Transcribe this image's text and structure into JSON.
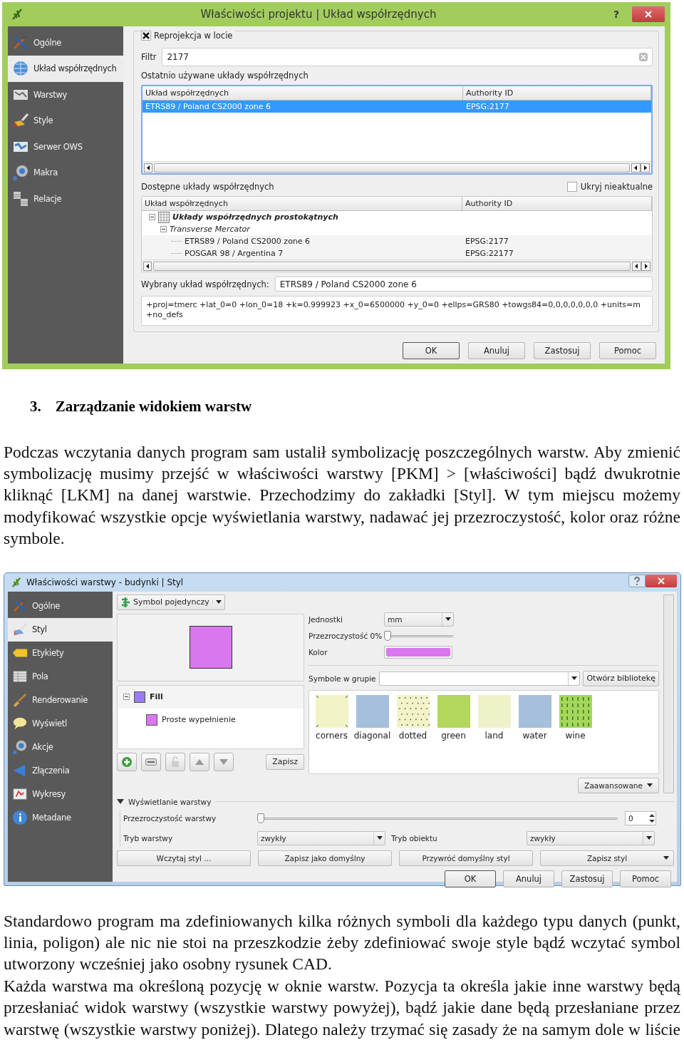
{
  "dialog1": {
    "title": "Właściwości projektu | Układ współrzędnych",
    "help": "?",
    "sidebar": [
      {
        "label": "Ogólne",
        "selected": false
      },
      {
        "label": "Układ współrzędnych",
        "selected": true
      },
      {
        "label": "Warstwy",
        "selected": false
      },
      {
        "label": "Style",
        "selected": false
      },
      {
        "label": "Serwer OWS",
        "selected": false
      },
      {
        "label": "Makra",
        "selected": false
      },
      {
        "label": "Relacje",
        "selected": false
      }
    ],
    "reprojection": {
      "label": "Reprojekcja w locie",
      "checked": true
    },
    "filter": {
      "label": "Filtr",
      "value": "2177"
    },
    "recent": {
      "label": "Ostatnio używane układy współrzędnych",
      "columns": [
        "Układ współrzędnych",
        "Authority ID"
      ],
      "rows": [
        {
          "cells": [
            "ETRS89 / Poland CS2000 zone 6",
            "EPSG:2177"
          ],
          "selected": true
        }
      ]
    },
    "available": {
      "label": "Dostępne układy współrzędnych",
      "hide_deprecated": {
        "label": "Ukryj nieaktualne",
        "checked": false
      },
      "columns": [
        "Układ współrzędnych",
        "Authority ID"
      ],
      "tree": [
        {
          "label": "Układy współrzędnych prostokątnych",
          "expanded": true,
          "children": [
            {
              "label": "Transverse Mercator",
              "expanded": true,
              "children": [
                {
                  "label": "ETRS89 / Poland CS2000 zone 6",
                  "authority_id": "EPSG:2177"
                },
                {
                  "label": "POSGAR 98 / Argentina 7",
                  "authority_id": "EPSG:22177"
                }
              ]
            }
          ]
        }
      ]
    },
    "selected_crs": {
      "label": "Wybrany układ współrzędnych:",
      "value": "ETRS89 / Poland CS2000 zone 6"
    },
    "proj_string": "+proj=tmerc +lat_0=0 +lon_0=18 +k=0.999923 +x_0=6500000 +y_0=0 +ellps=GRS80 +towgs84=0,0,0,0,0,0,0 +units=m +no_defs",
    "buttons": [
      {
        "label": "OK",
        "default": true
      },
      {
        "label": "Anuluj",
        "default": false
      },
      {
        "label": "Zastosuj",
        "default": false
      },
      {
        "label": "Pomoc",
        "default": false
      }
    ]
  },
  "section_heading": {
    "number": "3.",
    "text": "Zarządzanie widokiem warstw"
  },
  "paragraph_1": "Podczas wczytania danych program sam ustalił symbolizację poszczególnych warstw. Aby zmienić symbolizację musimy przejść w właściwości warstwy [PKM] > [właściwości] bądź dwukrotnie kliknąć [LKM] na danej warstwie. Przechodzimy do zakładki [Styl]. W tym miejscu możemy modyfikować wszystkie opcje wyświetlania warstwy, nadawać jej przezroczystość, kolor oraz różne symbole.",
  "dialog2": {
    "title": "Właściwości warstwy - budynki | Styl",
    "sidebar": [
      {
        "label": "Ogólne",
        "selected": false
      },
      {
        "label": "Styl",
        "selected": true
      },
      {
        "label": "Etykiety",
        "selected": false
      },
      {
        "label": "Pola",
        "selected": false
      },
      {
        "label": "Renderowanie",
        "selected": false
      },
      {
        "label": "Wyświetl",
        "selected": false
      },
      {
        "label": "Akcje",
        "selected": false
      },
      {
        "label": "Złączenia",
        "selected": false
      },
      {
        "label": "Wykresy",
        "selected": false
      },
      {
        "label": "Metadane",
        "selected": false
      }
    ],
    "renderer": "Symbol pojedynczy",
    "layers": [
      {
        "label": "Fill",
        "color": "#9a7cf0",
        "expanded": true,
        "children": [
          {
            "label": "Proste wypełnienie",
            "color": "#d977ee"
          }
        ]
      }
    ],
    "save_symbol": "Zapisz",
    "units": {
      "label": "Jednostki",
      "value": "mm"
    },
    "transparency": {
      "label": "Przezroczystość 0%",
      "level": 0
    },
    "color": {
      "label": "Kolor",
      "color": "#d977ee"
    },
    "group": {
      "label": "Symbole w grupie"
    },
    "open_library": "Otwórz bibliotekę",
    "symbols": [
      {
        "name": "corners",
        "color": "#f3f3c8",
        "kind": "corners"
      },
      {
        "name": "diagonal",
        "color": "#a6bfdc",
        "kind": "plain"
      },
      {
        "name": "dotted",
        "color": "#f3f3c8",
        "kind": "dots"
      },
      {
        "name": "green",
        "color": "#b3d75c",
        "kind": "plain"
      },
      {
        "name": "land",
        "color": "#eef2c9",
        "kind": "plain"
      },
      {
        "name": "water",
        "color": "#a6bfdc",
        "kind": "plain"
      },
      {
        "name": "wine",
        "color": "#a6d65a",
        "kind": "dashes"
      }
    ],
    "advanced": "Zaawansowane",
    "display": {
      "label": "Wyświetlanie warstwy",
      "expanded": true,
      "layer_transparency": {
        "label": "Przezroczystość warstwy",
        "level": 0,
        "value": "0"
      },
      "layer_mode": {
        "label": "Tryb warstwy",
        "value": "zwykły"
      },
      "feature_mode": {
        "label": "Tryb obiektu",
        "value": "zwykły"
      }
    },
    "style_buttons": [
      {
        "label": "Wczytaj styl ...",
        "menu": false
      },
      {
        "label": "Zapisz jako domyślny",
        "menu": false
      },
      {
        "label": "Przywróć domyślny styl",
        "menu": false
      },
      {
        "label": "Zapisz styl",
        "menu": true
      }
    ],
    "buttons": [
      {
        "label": "OK",
        "default": true
      },
      {
        "label": "Anuluj",
        "default": false
      },
      {
        "label": "Zastosuj",
        "default": false
      },
      {
        "label": "Pomoc",
        "default": false
      }
    ]
  },
  "paragraphs_2": [
    "Standardowo program ma zdefiniowanych kilka różnych symboli dla każdego typu danych (punkt, linia, poligon) ale nic nie stoi na przeszkodzie żeby zdefiniować swoje style bądź wczytać symbol utworzony wcześniej jako osobny rysunek CAD.",
    "Każda warstwa ma określoną pozycję w oknie warstw. Pozycja ta określa jakie inne warstwy będą przesłaniać widok warstwy (wszystkie warstwy powyżej), bądź jakie dane będą przesłaniane przez warstwę (wszystkie warstwy poniżej). Dlatego należy trzymać się zasady że na samym dole w liście"
  ]
}
